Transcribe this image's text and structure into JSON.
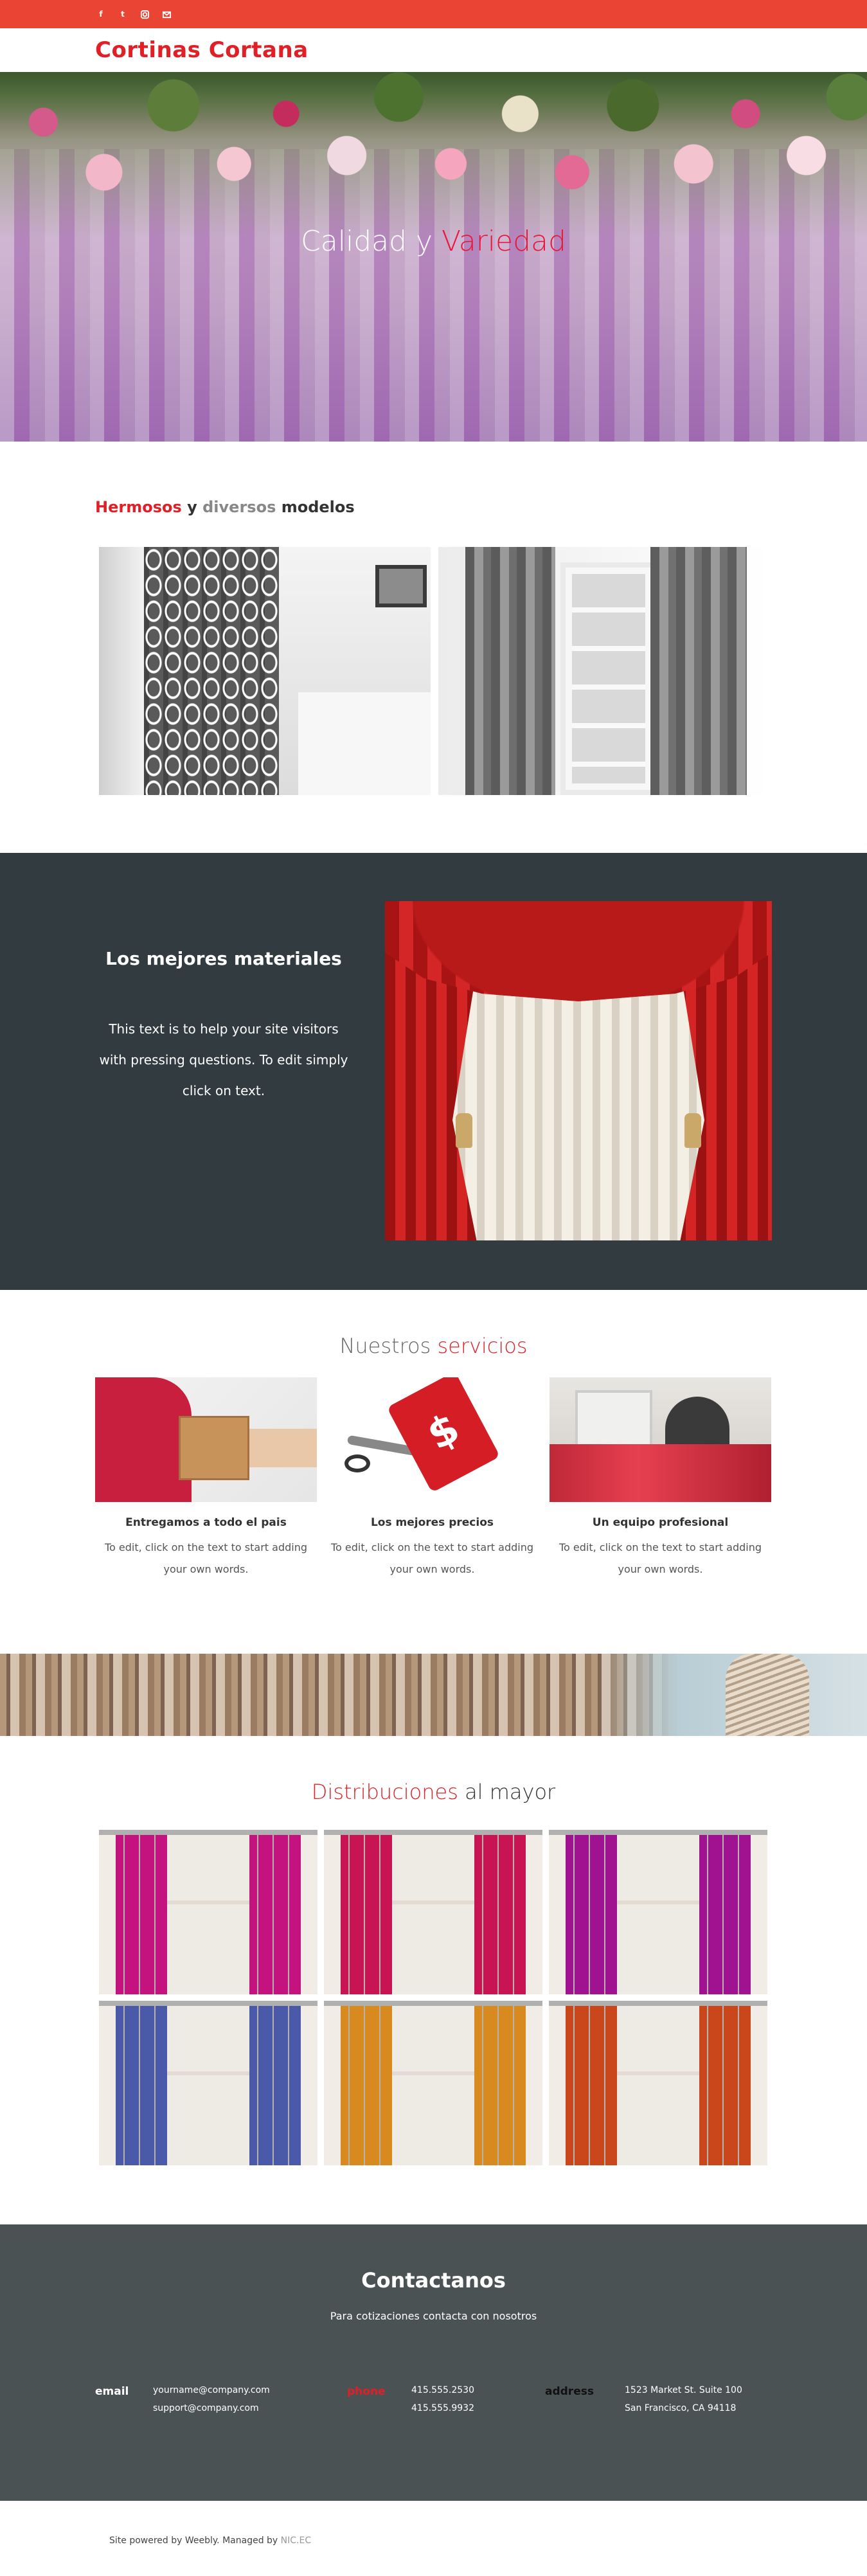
{
  "social": {
    "icons": [
      "facebook-icon",
      "twitter-icon",
      "instagram-icon",
      "mail-icon"
    ],
    "facebook_glyph": "f",
    "twitter_glyph": "t"
  },
  "header": {
    "site_title": "Cortinas Cortana"
  },
  "hero": {
    "title_part1": "Calidad y ",
    "title_part2": "Variedad"
  },
  "models": {
    "heading_red": "Hermosos",
    "heading_mid": " y ",
    "heading_grey": "diversos",
    "heading_end": " modelos"
  },
  "materials": {
    "heading": "Los mejores materiales",
    "body": "This text is to help your site visitors with pressing questions. To edit simply click on text."
  },
  "services": {
    "heading_grey": "Nuestros ",
    "heading_red": "servicios",
    "items": [
      {
        "title": "Entregamos a todo el pais",
        "text": "To edit, click on the text to start adding your own words."
      },
      {
        "title": "Los mejores precios",
        "text": "To edit, click on the text to start adding your own words."
      },
      {
        "title": "Un equipo profesional",
        "text": "To edit, click on the text to start adding your own words."
      }
    ]
  },
  "distribution": {
    "heading_red": "Distribuciones",
    "heading_end": " al mayor",
    "curtain_colors": [
      "#c4137f",
      "#c81452",
      "#a0128f",
      "#4a5aa8",
      "#d98a1e",
      "#c9471a"
    ]
  },
  "contact": {
    "heading": "Contactanos",
    "subtitle": "Para cotizaciones contacta con nosotros",
    "email_label": "email",
    "emails": [
      "yourname@company.com",
      "support@company.com"
    ],
    "phone_label": "phone",
    "phones": [
      "415.555.2530",
      "415.555.9932"
    ],
    "address_label": "address",
    "address": [
      "1523 Market St. Suite 100",
      "San Francisco, CA 94118"
    ]
  },
  "footer": {
    "text": "Site powered by Weebly. Managed by ",
    "link": "NIC.EC"
  },
  "colors": {
    "accent": "#e01f26",
    "topbar": "#e94434",
    "dark_section": "#323b40",
    "contact_bg": "#4b5253"
  }
}
